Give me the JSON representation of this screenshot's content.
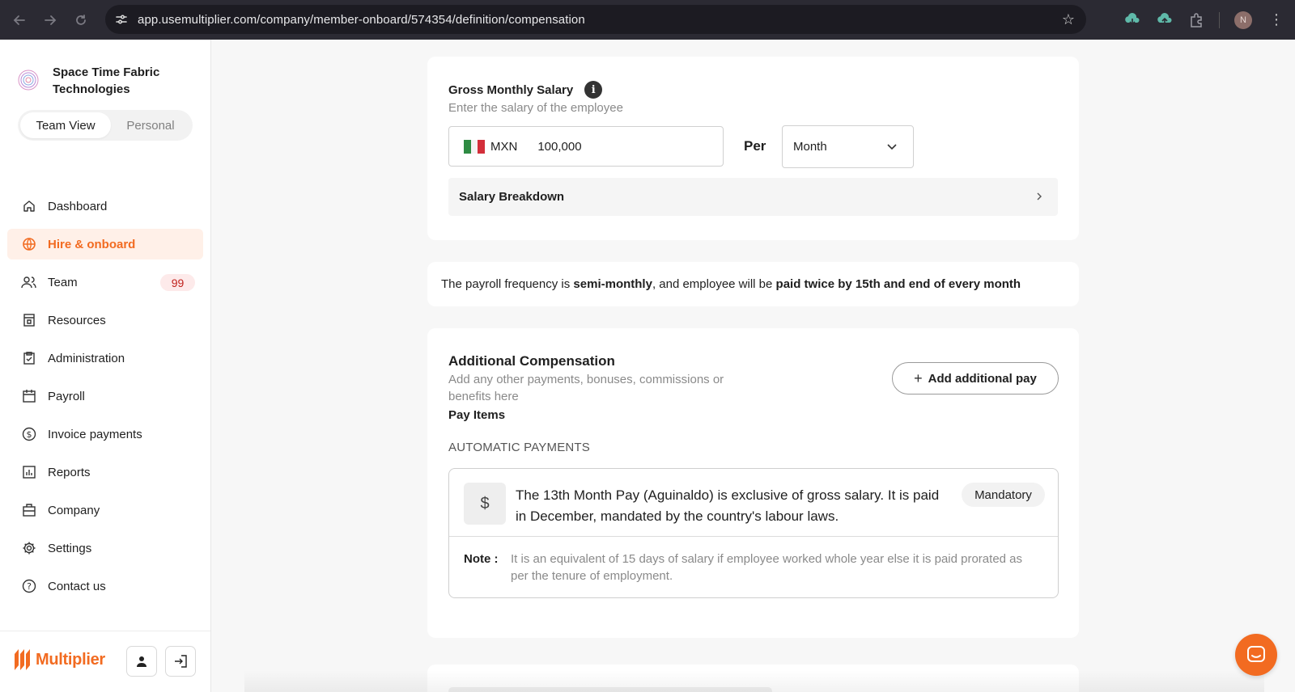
{
  "browser": {
    "url": "app.usemultiplier.com/company/member-onboard/574354/definition/compensation",
    "profile_initial": "N"
  },
  "sidebar": {
    "company_name": "Space Time Fabric Technologies",
    "view_toggle": {
      "active": "Team View",
      "inactive": "Personal"
    },
    "items": [
      {
        "label": "Dashboard",
        "icon": "home-icon"
      },
      {
        "label": "Hire & onboard",
        "icon": "globe-icon",
        "active": true
      },
      {
        "label": "Team",
        "icon": "users-icon",
        "badge": "99"
      },
      {
        "label": "Resources",
        "icon": "resources-icon"
      },
      {
        "label": "Administration",
        "icon": "clipboard-check-icon"
      },
      {
        "label": "Payroll",
        "icon": "calendar-icon"
      },
      {
        "label": "Invoice payments",
        "icon": "dollar-circle-icon"
      },
      {
        "label": "Reports",
        "icon": "bar-chart-icon"
      },
      {
        "label": "Company",
        "icon": "briefcase-icon"
      },
      {
        "label": "Settings",
        "icon": "gear-icon"
      },
      {
        "label": "Contact us",
        "icon": "help-circle-icon"
      }
    ],
    "footer_brand": "Multiplier"
  },
  "salary": {
    "title": "Gross Monthly Salary",
    "subtitle": "Enter the salary of the employee",
    "currency": "MXN",
    "amount": "100,000",
    "per_label": "Per",
    "period": "Month",
    "breakdown_label": "Salary Breakdown"
  },
  "payroll_frequency": {
    "prefix": "The payroll frequency is ",
    "frequency": "semi-monthly",
    "middle": ", and employee will be ",
    "schedule": "paid twice by 15th and end of every month"
  },
  "additional_compensation": {
    "title": "Additional Compensation",
    "subtitle": "Add any other payments, bonuses, commissions or benefits here",
    "add_button": "Add additional pay",
    "pay_items_label": "Pay Items",
    "automatic_payments_label": "AUTOMATIC PAYMENTS",
    "payment": {
      "description": "The 13th Month Pay (Aguinaldo) is exclusive of gross salary. It is paid in December, mandated by the country's labour laws.",
      "tag": "Mandatory",
      "note_label": "Note :",
      "note_text": "It is an equivalent of 15 days of salary if employee worked whole year else it is paid prorated as per the tenure of employment."
    }
  },
  "colors": {
    "accent": "#f26b21",
    "badge_text": "#c0221d",
    "active_nav_bg": "#fff0e8"
  }
}
